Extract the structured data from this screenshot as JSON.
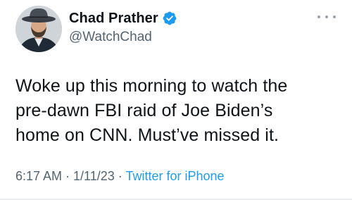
{
  "user": {
    "display_name": "Chad Prather",
    "handle": "@WatchChad",
    "verified": true
  },
  "tweet": {
    "text": "Woke up this morning to watch the\npre-dawn FBI raid of Joe Biden’s\nhome on CNN. Must’ve missed it.",
    "time": "6:17 AM",
    "separator": " · ",
    "date": "1/11/23",
    "source": "Twitter for iPhone"
  },
  "icons": {
    "verified_badge": "verified-badge-icon",
    "more": "more-options-icon"
  },
  "colors": {
    "text": "#0f1419",
    "secondary": "#536471",
    "accent": "#1d9bf0"
  }
}
